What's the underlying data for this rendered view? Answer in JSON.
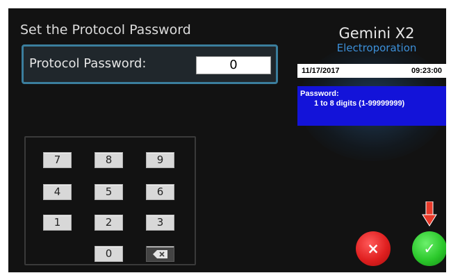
{
  "screen": {
    "title": "Set the Protocol Password"
  },
  "password": {
    "label": "Protocol Password:",
    "value": "0"
  },
  "brand": {
    "name": "Gemini X2",
    "subtitle": "Electroporation"
  },
  "status": {
    "date": "11/17/2017",
    "time": "09:23:00"
  },
  "info": {
    "line1": "Password:",
    "line2": "1 to 8 digits (1-99999999)"
  },
  "keypad": {
    "keys": [
      "7",
      "8",
      "9",
      "4",
      "5",
      "6",
      "1",
      "2",
      "3",
      "0"
    ],
    "backspace_icon": "backspace-icon"
  },
  "actions": {
    "cancel_label": "×",
    "cancel_icon": "close-icon",
    "ok_label": "✓",
    "ok_icon": "check-icon",
    "hint_icon": "arrow-down-icon"
  },
  "colors": {
    "background": "#121212",
    "info_box": "#1313d9",
    "brand_sub": "#3c8fd8",
    "cancel": "#e02020",
    "ok": "#2bc82b",
    "hint_arrow": "#e83a2a"
  }
}
